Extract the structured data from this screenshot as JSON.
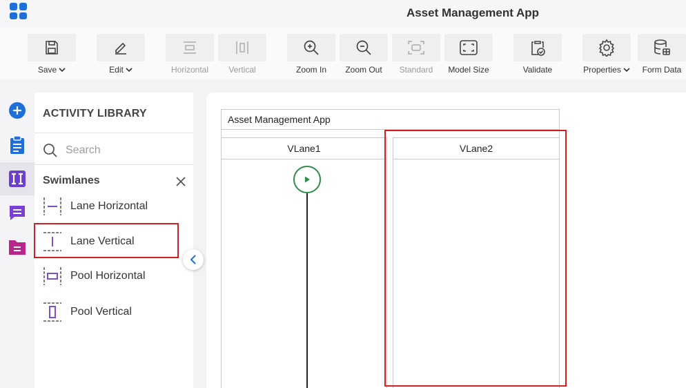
{
  "app": {
    "title": "Asset Management App"
  },
  "toolbar": {
    "items": [
      {
        "label": "Save",
        "icon": "save-icon",
        "dropdown": true,
        "enabled": true
      },
      {
        "label": "Edit",
        "icon": "edit-icon",
        "dropdown": true,
        "enabled": true
      },
      {
        "label": "Horizontal",
        "icon": "horizontal-icon",
        "dropdown": false,
        "enabled": false
      },
      {
        "label": "Vertical",
        "icon": "vertical-icon",
        "dropdown": false,
        "enabled": false
      },
      {
        "label": "Zoom In",
        "icon": "zoom-in-icon",
        "dropdown": false,
        "enabled": true
      },
      {
        "label": "Zoom Out",
        "icon": "zoom-out-icon",
        "dropdown": false,
        "enabled": true
      },
      {
        "label": "Standard",
        "icon": "standard-icon",
        "dropdown": false,
        "enabled": false
      },
      {
        "label": "Model Size",
        "icon": "model-size-icon",
        "dropdown": false,
        "enabled": true
      },
      {
        "label": "Validate",
        "icon": "validate-icon",
        "dropdown": false,
        "enabled": true
      },
      {
        "label": "Properties",
        "icon": "gear-icon",
        "dropdown": true,
        "enabled": true
      },
      {
        "label": "Form Data",
        "icon": "database-icon",
        "dropdown": false,
        "enabled": true
      }
    ]
  },
  "rail": {
    "items": [
      {
        "icon": "add-icon",
        "color": "#1e6fd9"
      },
      {
        "icon": "clipboard-icon",
        "color": "#1e6fd9"
      },
      {
        "icon": "swimlane-icon",
        "color": "#6a3fd0",
        "active": true
      },
      {
        "icon": "chat-icon",
        "color": "#7a3fd6"
      },
      {
        "icon": "document-icon",
        "color": "#b8288c"
      }
    ]
  },
  "library": {
    "title": "ACTIVITY LIBRARY",
    "search": {
      "placeholder": "Search",
      "value": ""
    },
    "section": {
      "title": "Swimlanes"
    },
    "items": [
      {
        "label": "Lane Horizontal",
        "icon": "lane-horizontal-icon"
      },
      {
        "label": "Lane Vertical",
        "icon": "lane-vertical-icon",
        "highlighted": true
      },
      {
        "label": "Pool Horizontal",
        "icon": "pool-horizontal-icon"
      },
      {
        "label": "Pool Vertical",
        "icon": "pool-vertical-icon"
      }
    ]
  },
  "canvas": {
    "pool_title": "Asset Management App",
    "lanes": [
      {
        "title": "VLane1"
      },
      {
        "title": "VLane2",
        "highlighted": true
      }
    ]
  },
  "colors": {
    "accent": "#1e6fd9",
    "purple": "#7a4fd8",
    "highlight": "#d11f1f",
    "start_event": "#2e8b4a"
  }
}
